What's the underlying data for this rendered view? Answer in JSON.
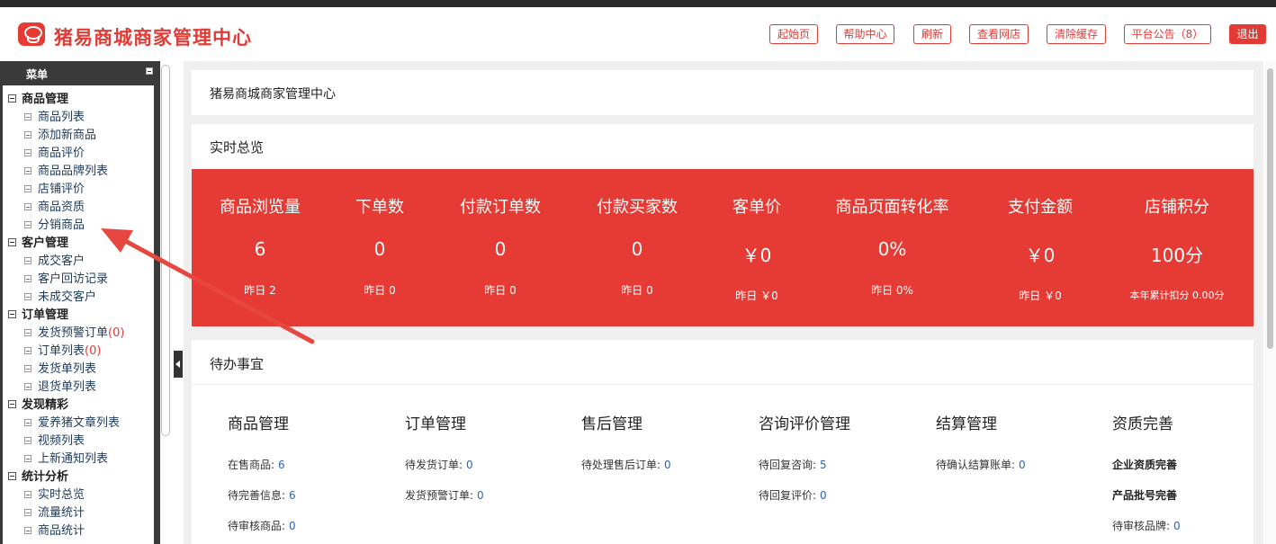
{
  "header": {
    "title": "猪易商城商家管理中心",
    "buttons": [
      "起始页",
      "帮助中心",
      "刷新",
      "查看网店",
      "清除缓存",
      "平台公告（8）",
      "退出"
    ],
    "accent": "#e23b35"
  },
  "sidebar": {
    "title": "菜单",
    "groups": [
      {
        "label": "商品管理",
        "items": [
          {
            "label": "商品列表"
          },
          {
            "label": "添加新商品"
          },
          {
            "label": "商品评价"
          },
          {
            "label": "商品品牌列表"
          },
          {
            "label": "店铺评价"
          },
          {
            "label": "商品资质"
          },
          {
            "label": "分销商品"
          }
        ]
      },
      {
        "label": "客户管理",
        "items": [
          {
            "label": "成交客户"
          },
          {
            "label": "客户回访记录"
          },
          {
            "label": "未成交客户"
          }
        ]
      },
      {
        "label": "订单管理",
        "items": [
          {
            "label": "发货预警订单",
            "count": "(0)"
          },
          {
            "label": "订单列表",
            "count": "(0)"
          },
          {
            "label": "发货单列表"
          },
          {
            "label": "退货单列表"
          }
        ]
      },
      {
        "label": "发现精彩",
        "items": [
          {
            "label": "爱养猪文章列表"
          },
          {
            "label": "视频列表"
          },
          {
            "label": "上新通知列表"
          }
        ]
      },
      {
        "label": "统计分析",
        "items": [
          {
            "label": "实时总览"
          },
          {
            "label": "流量统计"
          },
          {
            "label": "商品统计"
          }
        ]
      }
    ]
  },
  "main": {
    "breadcrumb": "猪易商城商家管理中心",
    "overview_title": "实时总览",
    "stats": [
      {
        "label": "商品浏览量",
        "value": "6",
        "sub": "昨日 2"
      },
      {
        "label": "下单数",
        "value": "0",
        "sub": "昨日 0"
      },
      {
        "label": "付款订单数",
        "value": "0",
        "sub": "昨日 0"
      },
      {
        "label": "付款买家数",
        "value": "0",
        "sub": "昨日 0"
      },
      {
        "label": "客单价",
        "value": "￥0",
        "sub": "昨日 ￥0"
      },
      {
        "label": "商品页面转化率",
        "value": "0%",
        "sub": "昨日 0%"
      },
      {
        "label": "支付金额",
        "value": "￥0",
        "sub": "昨日 ￥0"
      },
      {
        "label": "店铺积分",
        "value": "100分",
        "sub": "本年累计扣分 0.00分"
      }
    ],
    "todo_title": "待办事宜",
    "todo_columns": [
      {
        "title": "商品管理",
        "lines": [
          {
            "label": "在售商品:",
            "value": "6"
          },
          {
            "label": "待完善信息:",
            "value": "6"
          },
          {
            "label": "待审核商品:",
            "value": "0"
          }
        ]
      },
      {
        "title": "订单管理",
        "lines": [
          {
            "label": "待发货订单:",
            "value": "0"
          },
          {
            "label": "发货预警订单:",
            "value": "0"
          }
        ]
      },
      {
        "title": "售后管理",
        "lines": [
          {
            "label": "待处理售后订单:",
            "value": "0"
          }
        ]
      },
      {
        "title": "咨询评价管理",
        "lines": [
          {
            "label": "待回复咨询:",
            "value": "5"
          },
          {
            "label": "待回复评价:",
            "value": "0"
          }
        ]
      },
      {
        "title": "结算管理",
        "lines": [
          {
            "label": "待确认结算账单:",
            "value": "0"
          }
        ]
      },
      {
        "title": "资质完善",
        "lines": [
          {
            "label": "企业资质完善"
          },
          {
            "label": "产品批号完善"
          },
          {
            "label": "待审核品牌:",
            "value": "0"
          }
        ]
      }
    ]
  }
}
